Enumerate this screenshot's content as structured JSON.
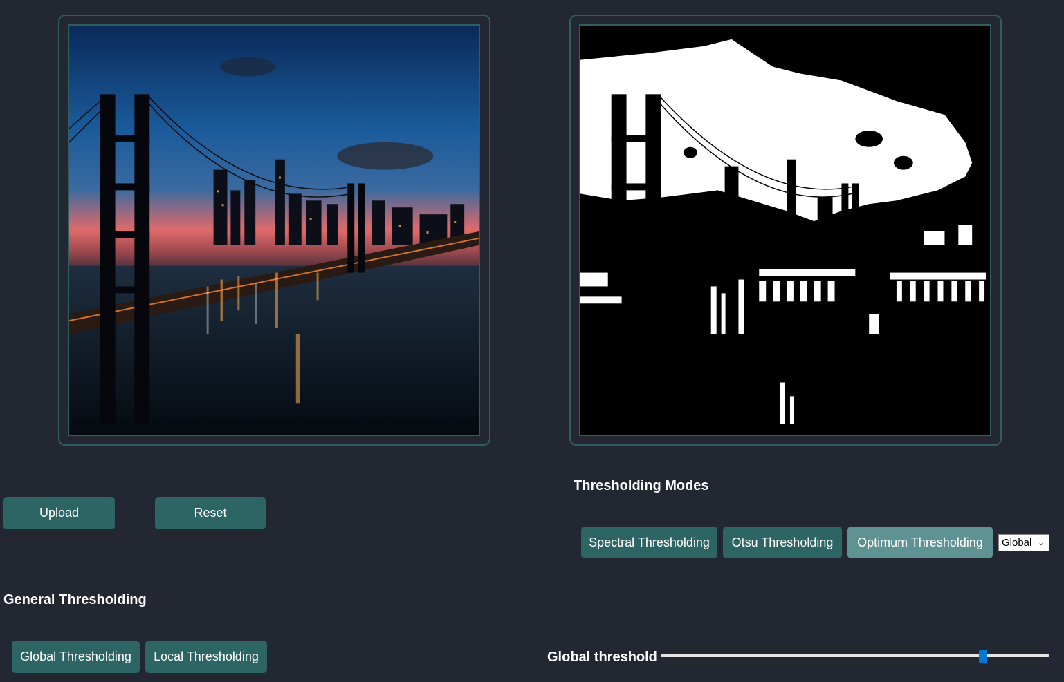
{
  "panels": {
    "input_image": {
      "alt": "Bridge at dusk (original)"
    },
    "output_image": {
      "alt": "Thresholded result"
    }
  },
  "controls": {
    "upload_label": "Upload",
    "reset_label": "Reset"
  },
  "general": {
    "heading": "General Thresholding",
    "global_label": "Global Thresholding",
    "local_label": "Local Thresholding"
  },
  "modes": {
    "heading": "Thresholding Modes",
    "spectral_label": "Spectral Thresholding",
    "otsu_label": "Otsu Thresholding",
    "optimum_label": "Optimum Thresholding",
    "active_mode": "Optimum Thresholding",
    "scope_select": {
      "selected": "Global"
    }
  },
  "slider": {
    "label": "Global threshold",
    "value_fraction": 0.83
  },
  "colors": {
    "background": "#222732",
    "button": "#2d6565",
    "button_active": "#5f9393",
    "panel_border": "#2d5f5f",
    "slider_thumb": "#0078d4"
  }
}
